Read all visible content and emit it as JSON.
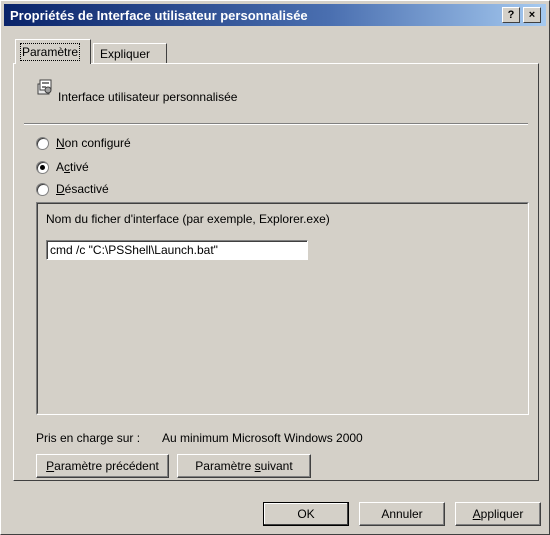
{
  "window": {
    "title": "Propriétés de Interface utilisateur personnalisée",
    "help_label": "?",
    "close_label": "×"
  },
  "tabs": [
    {
      "label": "Paramètre"
    },
    {
      "label": "Expliquer"
    }
  ],
  "policy": {
    "icon": "policy-setting-icon",
    "name": "Interface utilisateur personnalisée"
  },
  "radios": {
    "not_configured": {
      "prefix": "",
      "accel": "N",
      "rest": "on configuré"
    },
    "enabled": {
      "prefix": "A",
      "accel": "c",
      "rest": "tivé"
    },
    "disabled": {
      "prefix": "",
      "accel": "D",
      "rest": "ésactivé"
    },
    "selected": "enabled"
  },
  "options": {
    "field_label": "Nom du ficher d'interface (par exemple, Explorer.exe)",
    "field_value": "cmd /c \"C:\\PSShell\\Launch.bat\""
  },
  "supported": {
    "label": "Pris en charge sur :",
    "value": "Au minimum Microsoft Windows 2000"
  },
  "nav_buttons": {
    "prev": {
      "accel": "P",
      "rest": "aramètre précédent"
    },
    "next": {
      "prefix": "Paramètre ",
      "accel": "s",
      "rest": "uivant"
    }
  },
  "footer": {
    "ok": "OK",
    "cancel": "Annuler",
    "apply": {
      "accel": "A",
      "rest": "ppliquer"
    }
  }
}
